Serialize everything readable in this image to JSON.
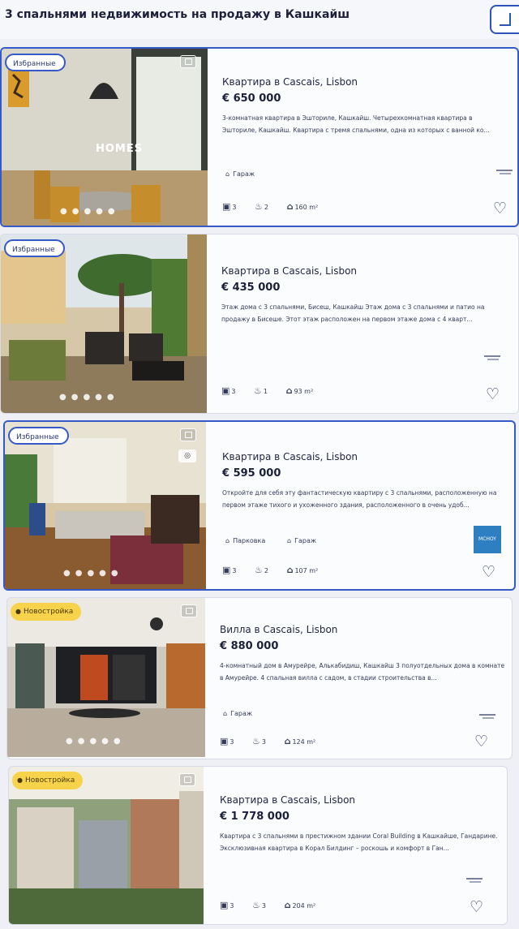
{
  "header": {
    "title": "3 спальнями недвижимость на продажу в Кашкайш"
  },
  "listings": [
    {
      "badge": "Избранные",
      "title": "Квартира в Cascais, Lisbon",
      "price": "€ 650 000",
      "description": "3-комнатная квартира в Эшториле, Кашкайш. Четырехкомнатная квартира в Эшториле, Кашкайш. Квартира с тремя спальнями, одна из которых с ванной ко...",
      "features": [
        "Гараж"
      ],
      "beds": "3",
      "baths": "2",
      "area": "160 m²",
      "watermark": "HOMES"
    },
    {
      "badge": "Избранные",
      "title": "Квартира в Cascais, Lisbon",
      "price": "€ 435 000",
      "description": "Этаж дома с 3 спальнями, Бисеш, Кашкайш Этаж дома с 3 спальнями и патио на продажу в Бисеше. Этот этаж расположен на первом этаже дома с 4 кварт...",
      "features": [],
      "beds": "3",
      "baths": "1",
      "area": "93 m²"
    },
    {
      "badge": "Избранные",
      "title": "Квартира в Cascais, Lisbon",
      "price": "€ 595 000",
      "description": "Откройте для себя эту фантастическую квартиру с 3 спальнями, расположенную на первом этаже тихого и ухоженного здания, расположенного в очень удоб...",
      "features": [
        "Парковка",
        "Гараж"
      ],
      "beds": "3",
      "baths": "2",
      "area": "107 m²",
      "agency": "MCHOY"
    },
    {
      "badge": "Новостройка",
      "title": "Вилла в Cascais, Lisbon",
      "price": "€ 880 000",
      "description": "4-комнатный дом в Амурейре, Алькабидиш, Кашкайш 3 полуотдельных дома в комнате в Амурейре. 4 спальная вилла с садом, в стадии строительства в...",
      "features": [
        "Гараж"
      ],
      "beds": "3",
      "baths": "3",
      "area": "124 m²"
    },
    {
      "badge": "Новостройка",
      "title": "Квартира в Cascais, Lisbon",
      "price": "€ 1 778 000",
      "description": "Квартира с 3 спальнями в престижном здании Coral Building в Кашкайше, Гандарине. Эксклюзивная квартира в Корал Билдинг – роскошь и комфорт в Ган...",
      "features": [],
      "beds": "3",
      "baths": "3",
      "area": "204 m²"
    }
  ],
  "icons": {
    "bed": "bed-icon",
    "bath": "bath-icon",
    "area": "house-area-icon",
    "garage": "garage-icon",
    "parking": "parking-icon",
    "heart": "heart-icon",
    "photos": "photo-gallery-icon"
  },
  "colors": {
    "accent": "#3559c7",
    "badge_new": "#f6d34a",
    "text": "#1c1f3a"
  }
}
